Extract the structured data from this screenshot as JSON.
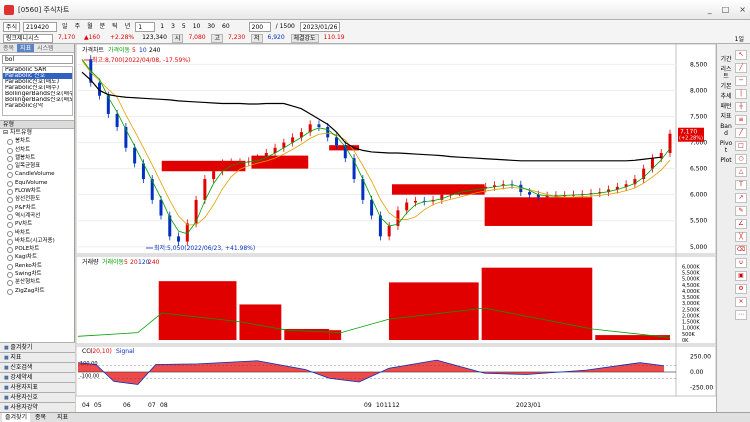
{
  "window": {
    "title": "[0560] 주식차트",
    "controls": [
      "_",
      "□",
      "×"
    ]
  },
  "toolbar": {
    "market": "주식",
    "code": "219420",
    "period_buttons": [
      "일",
      "주",
      "월",
      "분",
      "틱",
      "년"
    ],
    "interval_buttons": [
      "1",
      "3",
      "5",
      "10",
      "30",
      "60"
    ],
    "interval_value": "1",
    "count_value": "200",
    "total_count": "/ 1500",
    "date": "2023/01/26"
  },
  "quote": {
    "name": "링크제니시스",
    "price": "7,170",
    "change": "▲160",
    "change_pct": "+2.28%",
    "volume": "123,340",
    "open_label": "시",
    "open": "7,080",
    "high_label": "고",
    "high": "7,230",
    "low_label": "저",
    "low": "6,920",
    "strength_label": "체결강도",
    "strength": "110.19",
    "right_tag": "1일"
  },
  "left_panel": {
    "tabs": [
      "종목",
      "지표",
      "시스템"
    ],
    "active_tab": "지표",
    "search_value": "bol",
    "search_results": [
      "Parabolic SAR",
      "Parabolic 신호",
      "Parabolic신호(매도)",
      "Parabolic신호(매수)",
      "BollingerBands신호(매수)",
      "BollingerBands신호(매도)",
      "Parabolic강약"
    ],
    "selected_result": "Parabolic 신호",
    "section_title": "유형",
    "tree_root": "차트유형",
    "chart_types": [
      "봉차트",
      "선차트",
      "캘봉차트",
      "일목균형표",
      "CandleVolume",
      "EquiVolume",
      "FLOW차트",
      "삼선전환도",
      "P&F차트",
      "역시계곡선",
      "PV차트",
      "바차트",
      "바차트(시고저종)",
      "POLE차트",
      "Kagi차트",
      "Renko차트",
      "Swing차트",
      "분산형차트",
      "ZigZag차트"
    ],
    "bottom_items": [
      "즐겨찾기",
      "지표",
      "신호검색",
      "강세약세",
      "사용자지표",
      "사용자신호",
      "사용자강약"
    ]
  },
  "right_bar": {
    "vertical_labels": [
      "기간",
      "리스트",
      "기본",
      "추세",
      "패턴",
      "지표",
      "Band",
      "Pivot",
      "Plot"
    ]
  },
  "bottom_tabs": [
    "즐겨찾기",
    "종목",
    "지표"
  ],
  "colors": {
    "up": "#e00000",
    "down": "#0030c0",
    "ma5": "#e00000",
    "ma10": "#0030c0",
    "ma20": "#e0a000",
    "ma120": "#00a000",
    "ma240": "#000000"
  },
  "chart_data": [
    {
      "type": "candlestick",
      "legend": [
        "가격차트",
        "가격이동",
        "5",
        "10",
        "240"
      ],
      "y_ticks": [
        "8,500",
        "8,000",
        "7,500",
        "7,000",
        "6,500",
        "6,000",
        "5,500",
        "5,000"
      ],
      "ylim": [
        4900,
        8700
      ],
      "x_ticks": [
        "04",
        "05",
        "06",
        "07",
        "08",
        "09",
        "10",
        "11",
        "12",
        "2023/01"
      ],
      "annotations": [
        {
          "text": "최고:8,700(2022/04/08, -17.59%)",
          "price": 8700
        },
        {
          "text": "최저:5,050(2022/06/23, +41.98%)",
          "price": 5050
        }
      ],
      "current_price_tag": [
        "7,170",
        "(+2.28%)"
      ],
      "close_series": [
        8600,
        8150,
        7900,
        7550,
        7300,
        6900,
        6600,
        6300,
        5900,
        5600,
        5200,
        5100,
        5450,
        5900,
        6300,
        6450,
        6600,
        6620,
        6620,
        6640,
        6700,
        6800,
        6900,
        7000,
        7100,
        7200,
        7350,
        7300,
        7100,
        6950,
        6700,
        6300,
        5900,
        5600,
        5200,
        5400,
        5700,
        5850,
        5880,
        5870,
        5900,
        6000,
        6050,
        6080,
        6100,
        6120,
        6150,
        6180,
        6200,
        6190,
        6050,
        6000,
        5950,
        5980,
        5990,
        5990,
        6000,
        6010,
        6030,
        6050,
        6100,
        6150,
        6200,
        6300,
        6500,
        6700,
        6800,
        7170
      ],
      "ma240": [
        8350,
        8200,
        8000,
        7920,
        7890,
        7870,
        7860,
        7850,
        7840,
        7830,
        7820,
        7800,
        7790,
        7780,
        7770,
        7760,
        7750,
        7750,
        7750,
        7740,
        7740,
        7750,
        7750,
        7750,
        7700,
        7650,
        7550,
        7450,
        7350,
        7200,
        7000,
        6900,
        6850,
        6820,
        6810,
        6800,
        6800,
        6790,
        6780,
        6770,
        6760,
        6750,
        6730,
        6720,
        6710,
        6700,
        6690,
        6680,
        6670,
        6660,
        6650,
        6650,
        6650,
        6650,
        6650,
        6650,
        6650,
        6650,
        6650,
        6650,
        6650,
        6650,
        6650,
        6660,
        6680,
        6700,
        6720
      ]
    },
    {
      "type": "bar",
      "legend": [
        "거래량",
        "거래이동",
        "5",
        "20",
        "120",
        "240"
      ],
      "y_ticks": [
        "6,000K",
        "5,500K",
        "5,000K",
        "4,500K",
        "4,000K",
        "3,500K",
        "3,000K",
        "2,500K",
        "2,000K",
        "1,500K",
        "1,000K",
        "500K",
        "0K"
      ],
      "ylim": [
        0,
        6200
      ],
      "boxes": [
        {
          "start": 0.135,
          "end": 0.265,
          "value": 4800
        },
        {
          "start": 0.27,
          "end": 0.34,
          "value": 2900
        },
        {
          "start": 0.345,
          "end": 0.42,
          "value": 900
        },
        {
          "start": 0.42,
          "end": 0.44,
          "value": 800
        },
        {
          "start": 0.52,
          "end": 0.67,
          "value": 4700
        },
        {
          "start": 0.675,
          "end": 0.86,
          "value": 5900
        },
        {
          "start": 0.865,
          "end": 0.99,
          "value": 400
        }
      ]
    },
    {
      "type": "line",
      "legend": [
        "CCI",
        "(20,10)",
        "Signal"
      ],
      "y_ticks": [
        "250.00",
        "0.00",
        "-250.00"
      ],
      "levels": [
        "100.00",
        "-100.00"
      ],
      "ylim": [
        -320,
        320
      ]
    }
  ]
}
